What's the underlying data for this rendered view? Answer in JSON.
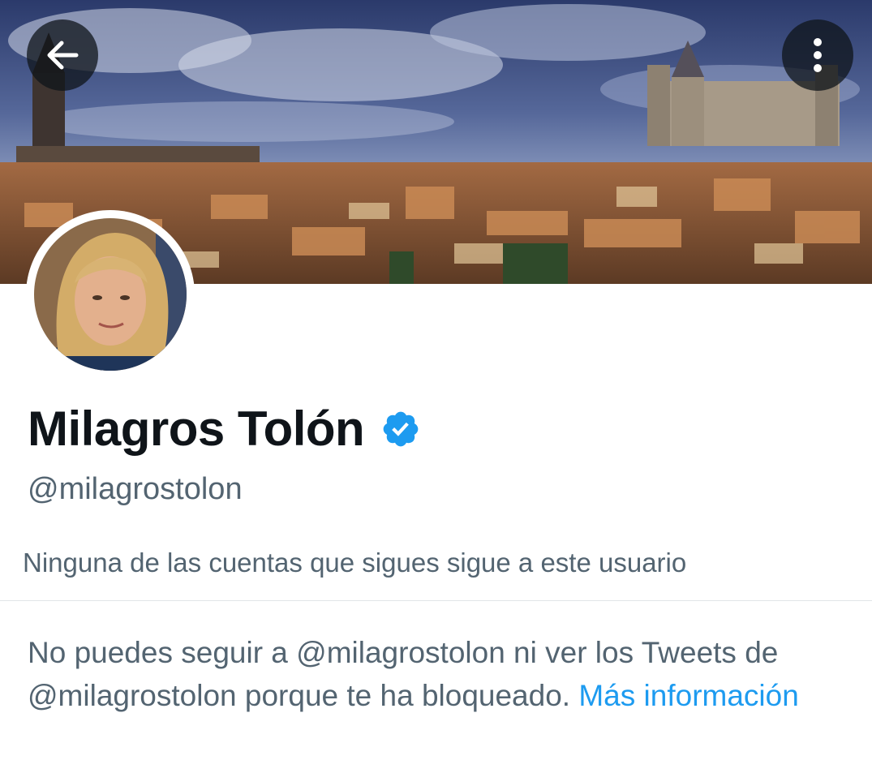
{
  "profile": {
    "display_name": "Milagros Tolón",
    "handle": "@milagrostolon",
    "verified": true,
    "followers_note": "Ninguna de las cuentas que sigues sigue a este usuario"
  },
  "blocked_notice": {
    "message": "No puedes seguir a @milagrostolon ni ver los Tweets de @milagrostolon porque te ha bloqueado.",
    "link_label": "Más información"
  },
  "icons": {
    "back": "arrow-left-icon",
    "more": "more-vertical-icon",
    "verified": "verified-badge-icon"
  },
  "colors": {
    "accent": "#1d9bf0",
    "text_primary": "#0f1419",
    "text_secondary": "#536471"
  }
}
